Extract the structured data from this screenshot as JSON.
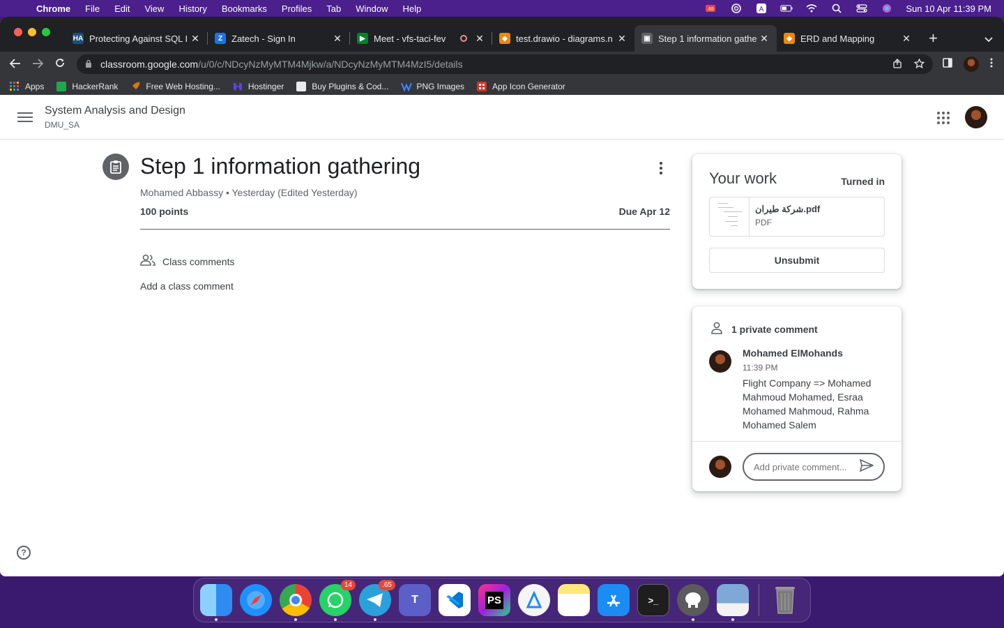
{
  "menubar": {
    "app": "Chrome",
    "items": [
      "File",
      "Edit",
      "View",
      "History",
      "Bookmarks",
      "Profiles",
      "Tab",
      "Window",
      "Help"
    ],
    "badge": ".65",
    "clock": "Sun 10 Apr  11:39 PM"
  },
  "tabs": [
    {
      "title": "Protecting Against SQL I",
      "favicon_color": "#1f4e79",
      "favicon_text": "HA"
    },
    {
      "title": "Zatech - Sign In",
      "favicon_color": "#1a73e8",
      "favicon_text": "Z"
    },
    {
      "title": "Meet - vfs-taci-fev",
      "favicon_color": "#00832d",
      "favicon_text": "▶"
    },
    {
      "title": "test.drawio - diagrams.n",
      "favicon_color": "#f08705",
      "favicon_text": "◆"
    },
    {
      "title": "Step 1 information gathe",
      "favicon_color": "#5f6368",
      "favicon_text": "▣"
    },
    {
      "title": "ERD and Mapping",
      "favicon_color": "#f08705",
      "favicon_text": "◆"
    }
  ],
  "address": {
    "host": "classroom.google.com",
    "path": "/u/0/c/NDcyNzMyMTM4Mjkw/a/NDcyNzMyMTM4MzI5/details"
  },
  "bookmarks": [
    {
      "label": "Apps",
      "color": "#4285f4"
    },
    {
      "label": "HackerRank",
      "color": "#1ba94c"
    },
    {
      "label": "Free Web Hosting...",
      "color": "#e37400"
    },
    {
      "label": "Hostinger",
      "color": "#673de6"
    },
    {
      "label": "Buy Plugins & Cod...",
      "color": "#e8eaed"
    },
    {
      "label": "PNG Images",
      "color": "#3b82f6"
    },
    {
      "label": "App Icon Generator",
      "color": "#d93025"
    }
  ],
  "course": {
    "title": "System Analysis and Design",
    "section": "DMU_SA"
  },
  "assignment": {
    "title": "Step 1 information gathering",
    "meta": "Mohamed Abbassy • Yesterday (Edited Yesterday)",
    "points": "100 points",
    "due": "Due Apr 12",
    "class_comments_label": "Class comments",
    "add_comment": "Add a class comment"
  },
  "your_work": {
    "title": "Your work",
    "status": "Turned in",
    "attachment_name": "شركة طيران.pdf",
    "attachment_type": "PDF",
    "unsubmit_label": "Unsubmit"
  },
  "private_comments": {
    "header": "1 private comment",
    "author": "Mohamed ElMohands",
    "time": "11:39 PM",
    "body": "Flight Company => Mohamed Mahmoud Mohamed, Esraa Mohamed Mahmoud, Rahma Mohamed Salem",
    "input_placeholder": "Add private comment..."
  },
  "dock": [
    {
      "name": "finder",
      "color": "#2d8cf0",
      "label": ""
    },
    {
      "name": "safari",
      "color": "#1e90ff",
      "label": ""
    },
    {
      "name": "chrome",
      "color": "#e8eaed",
      "label": ""
    },
    {
      "name": "whatsapp",
      "color": "#25d366",
      "label": "",
      "badge": "14"
    },
    {
      "name": "telegram",
      "color": "#2aa1da",
      "label": "",
      "badge": ".65"
    },
    {
      "name": "teams",
      "color": "#5b5fc7",
      "label": ""
    },
    {
      "name": "vscode",
      "color": "#ffffff",
      "label": ""
    },
    {
      "name": "phpstorm",
      "color": "#a21fe0",
      "label": "PS"
    },
    {
      "name": "xcode-instruments",
      "color": "#f5f5f5",
      "label": ""
    },
    {
      "name": "notes",
      "color": "#fbe77a",
      "label": ""
    },
    {
      "name": "app-store",
      "color": "#1b8cf3",
      "label": ""
    },
    {
      "name": "terminal",
      "color": "#1e1e1e",
      "label": ">_"
    },
    {
      "name": "tableplus",
      "color": "#5b5b5b",
      "label": ""
    },
    {
      "name": "preview",
      "color": "#7fa8d8",
      "label": ""
    }
  ]
}
